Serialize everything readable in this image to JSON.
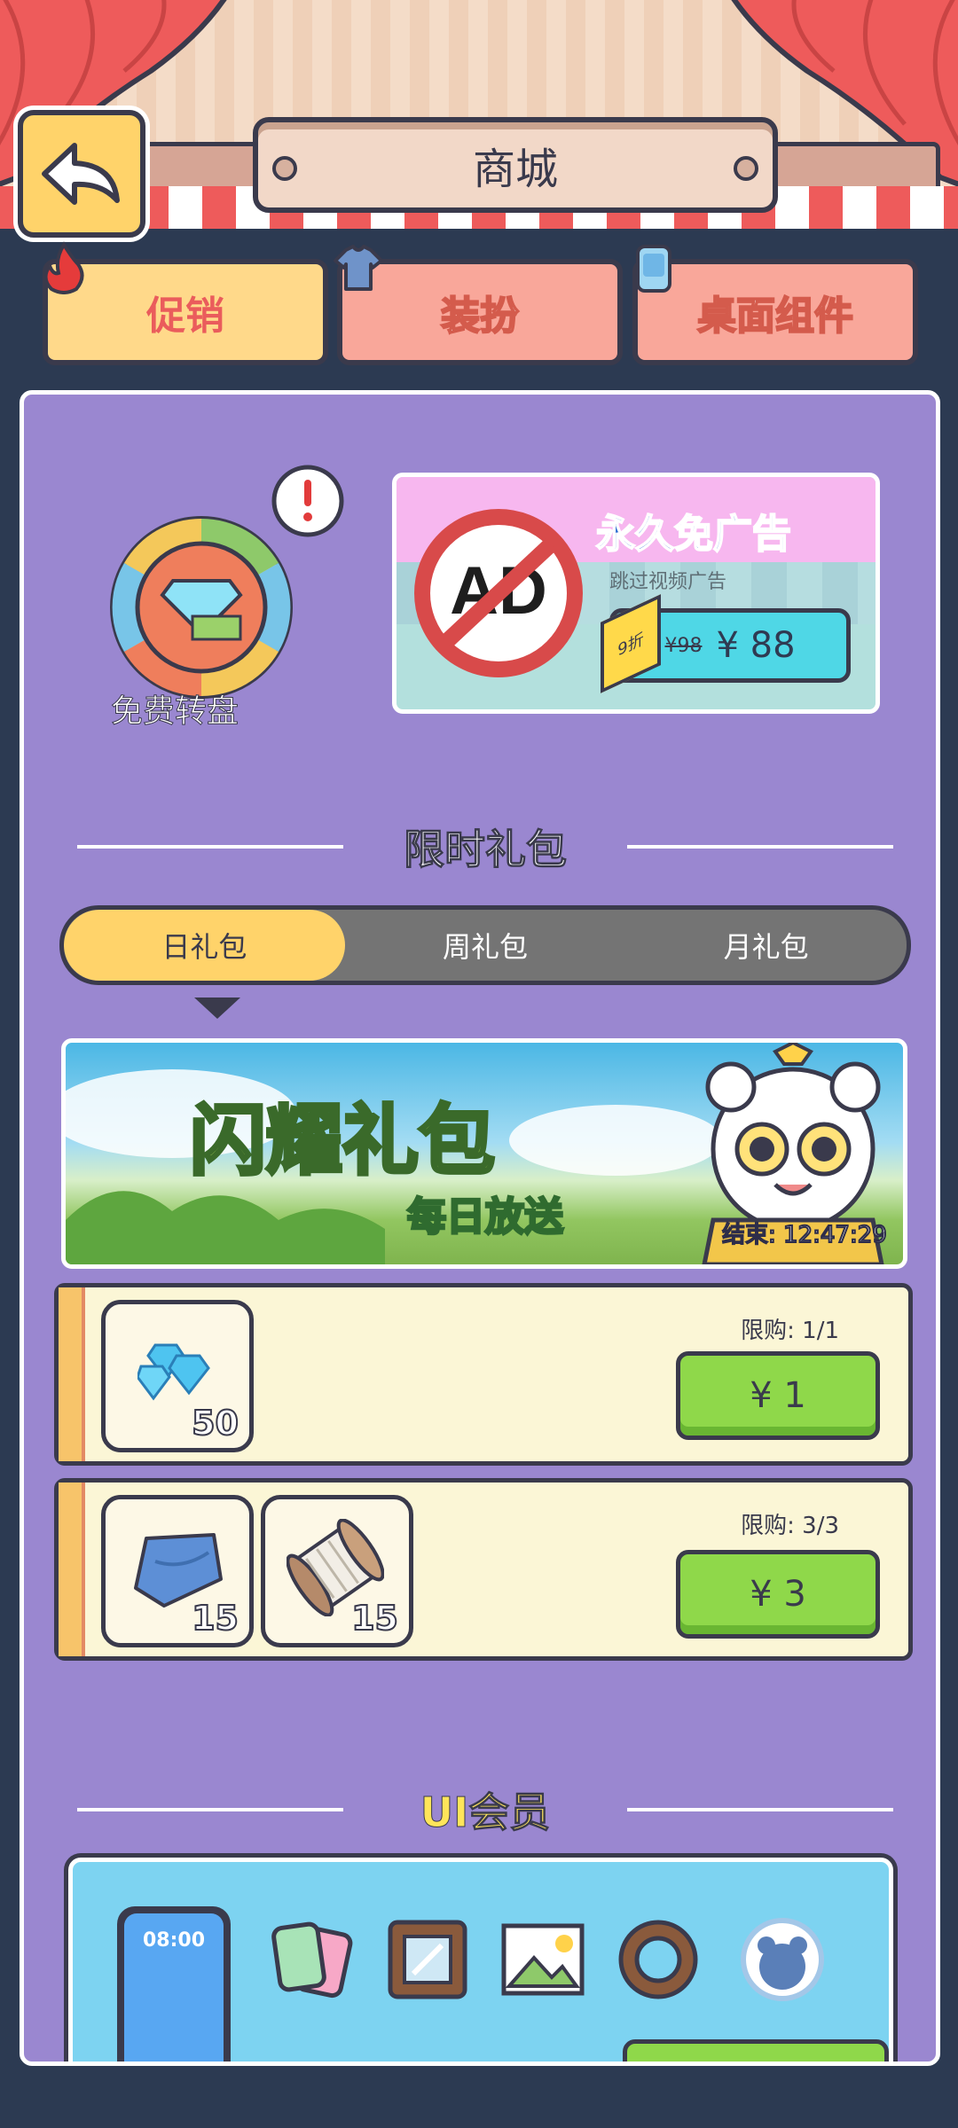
{
  "header": {
    "title": "商城",
    "back_label": "back"
  },
  "category_tabs": [
    {
      "label": "促销",
      "icon": "fire-icon"
    },
    {
      "label": "装扮",
      "icon": "shirt-icon"
    },
    {
      "label": "桌面组件",
      "icon": "phone-widget-icon"
    }
  ],
  "promo": {
    "wheel_label": "免费转盘",
    "ad": {
      "title": "永久免广告",
      "subtitle": "跳过视频广告",
      "discount": "9折",
      "old_price": "¥98",
      "price": "¥ 88"
    }
  },
  "limited_section": {
    "title": "限时礼包",
    "tabs": [
      "日礼包",
      "周礼包",
      "月礼包"
    ],
    "active_tab": "日礼包",
    "banner": {
      "title": "闪耀礼包",
      "subtitle": "每日放送",
      "timer": "结束: 12:47:29"
    },
    "packs": [
      {
        "limit": "限购: 1/1",
        "price": "¥ 1",
        "items": [
          {
            "icon": "diamond-icon",
            "count": "50"
          }
        ]
      },
      {
        "limit": "限购: 3/3",
        "price": "¥ 3",
        "items": [
          {
            "icon": "cloth-icon",
            "count": "15"
          },
          {
            "icon": "thread-spool-icon",
            "count": "15"
          }
        ]
      }
    ]
  },
  "vip_section": {
    "title": "UI会员",
    "phone_time": "08:00"
  },
  "colors": {
    "background": "#2c3a52",
    "panel": "#9a87d0",
    "yellow": "#ffd36a",
    "salmon": "#f9a79a",
    "green": "#8fd84a",
    "curtain": "#ee5b5b"
  }
}
